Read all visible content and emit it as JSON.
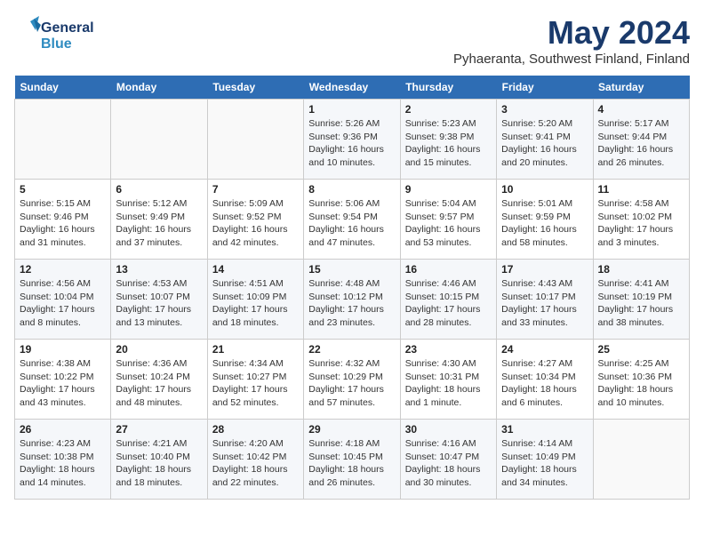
{
  "header": {
    "logo_line1": "General",
    "logo_line2": "Blue",
    "month_year": "May 2024",
    "location": "Pyhaeranta, Southwest Finland, Finland"
  },
  "weekdays": [
    "Sunday",
    "Monday",
    "Tuesday",
    "Wednesday",
    "Thursday",
    "Friday",
    "Saturday"
  ],
  "weeks": [
    [
      {
        "day": "",
        "content": ""
      },
      {
        "day": "",
        "content": ""
      },
      {
        "day": "",
        "content": ""
      },
      {
        "day": "1",
        "content": "Sunrise: 5:26 AM\nSunset: 9:36 PM\nDaylight: 16 hours\nand 10 minutes."
      },
      {
        "day": "2",
        "content": "Sunrise: 5:23 AM\nSunset: 9:38 PM\nDaylight: 16 hours\nand 15 minutes."
      },
      {
        "day": "3",
        "content": "Sunrise: 5:20 AM\nSunset: 9:41 PM\nDaylight: 16 hours\nand 20 minutes."
      },
      {
        "day": "4",
        "content": "Sunrise: 5:17 AM\nSunset: 9:44 PM\nDaylight: 16 hours\nand 26 minutes."
      }
    ],
    [
      {
        "day": "5",
        "content": "Sunrise: 5:15 AM\nSunset: 9:46 PM\nDaylight: 16 hours\nand 31 minutes."
      },
      {
        "day": "6",
        "content": "Sunrise: 5:12 AM\nSunset: 9:49 PM\nDaylight: 16 hours\nand 37 minutes."
      },
      {
        "day": "7",
        "content": "Sunrise: 5:09 AM\nSunset: 9:52 PM\nDaylight: 16 hours\nand 42 minutes."
      },
      {
        "day": "8",
        "content": "Sunrise: 5:06 AM\nSunset: 9:54 PM\nDaylight: 16 hours\nand 47 minutes."
      },
      {
        "day": "9",
        "content": "Sunrise: 5:04 AM\nSunset: 9:57 PM\nDaylight: 16 hours\nand 53 minutes."
      },
      {
        "day": "10",
        "content": "Sunrise: 5:01 AM\nSunset: 9:59 PM\nDaylight: 16 hours\nand 58 minutes."
      },
      {
        "day": "11",
        "content": "Sunrise: 4:58 AM\nSunset: 10:02 PM\nDaylight: 17 hours\nand 3 minutes."
      }
    ],
    [
      {
        "day": "12",
        "content": "Sunrise: 4:56 AM\nSunset: 10:04 PM\nDaylight: 17 hours\nand 8 minutes."
      },
      {
        "day": "13",
        "content": "Sunrise: 4:53 AM\nSunset: 10:07 PM\nDaylight: 17 hours\nand 13 minutes."
      },
      {
        "day": "14",
        "content": "Sunrise: 4:51 AM\nSunset: 10:09 PM\nDaylight: 17 hours\nand 18 minutes."
      },
      {
        "day": "15",
        "content": "Sunrise: 4:48 AM\nSunset: 10:12 PM\nDaylight: 17 hours\nand 23 minutes."
      },
      {
        "day": "16",
        "content": "Sunrise: 4:46 AM\nSunset: 10:15 PM\nDaylight: 17 hours\nand 28 minutes."
      },
      {
        "day": "17",
        "content": "Sunrise: 4:43 AM\nSunset: 10:17 PM\nDaylight: 17 hours\nand 33 minutes."
      },
      {
        "day": "18",
        "content": "Sunrise: 4:41 AM\nSunset: 10:19 PM\nDaylight: 17 hours\nand 38 minutes."
      }
    ],
    [
      {
        "day": "19",
        "content": "Sunrise: 4:38 AM\nSunset: 10:22 PM\nDaylight: 17 hours\nand 43 minutes."
      },
      {
        "day": "20",
        "content": "Sunrise: 4:36 AM\nSunset: 10:24 PM\nDaylight: 17 hours\nand 48 minutes."
      },
      {
        "day": "21",
        "content": "Sunrise: 4:34 AM\nSunset: 10:27 PM\nDaylight: 17 hours\nand 52 minutes."
      },
      {
        "day": "22",
        "content": "Sunrise: 4:32 AM\nSunset: 10:29 PM\nDaylight: 17 hours\nand 57 minutes."
      },
      {
        "day": "23",
        "content": "Sunrise: 4:30 AM\nSunset: 10:31 PM\nDaylight: 18 hours\nand 1 minute."
      },
      {
        "day": "24",
        "content": "Sunrise: 4:27 AM\nSunset: 10:34 PM\nDaylight: 18 hours\nand 6 minutes."
      },
      {
        "day": "25",
        "content": "Sunrise: 4:25 AM\nSunset: 10:36 PM\nDaylight: 18 hours\nand 10 minutes."
      }
    ],
    [
      {
        "day": "26",
        "content": "Sunrise: 4:23 AM\nSunset: 10:38 PM\nDaylight: 18 hours\nand 14 minutes."
      },
      {
        "day": "27",
        "content": "Sunrise: 4:21 AM\nSunset: 10:40 PM\nDaylight: 18 hours\nand 18 minutes."
      },
      {
        "day": "28",
        "content": "Sunrise: 4:20 AM\nSunset: 10:42 PM\nDaylight: 18 hours\nand 22 minutes."
      },
      {
        "day": "29",
        "content": "Sunrise: 4:18 AM\nSunset: 10:45 PM\nDaylight: 18 hours\nand 26 minutes."
      },
      {
        "day": "30",
        "content": "Sunrise: 4:16 AM\nSunset: 10:47 PM\nDaylight: 18 hours\nand 30 minutes."
      },
      {
        "day": "31",
        "content": "Sunrise: 4:14 AM\nSunset: 10:49 PM\nDaylight: 18 hours\nand 34 minutes."
      },
      {
        "day": "",
        "content": ""
      }
    ]
  ]
}
